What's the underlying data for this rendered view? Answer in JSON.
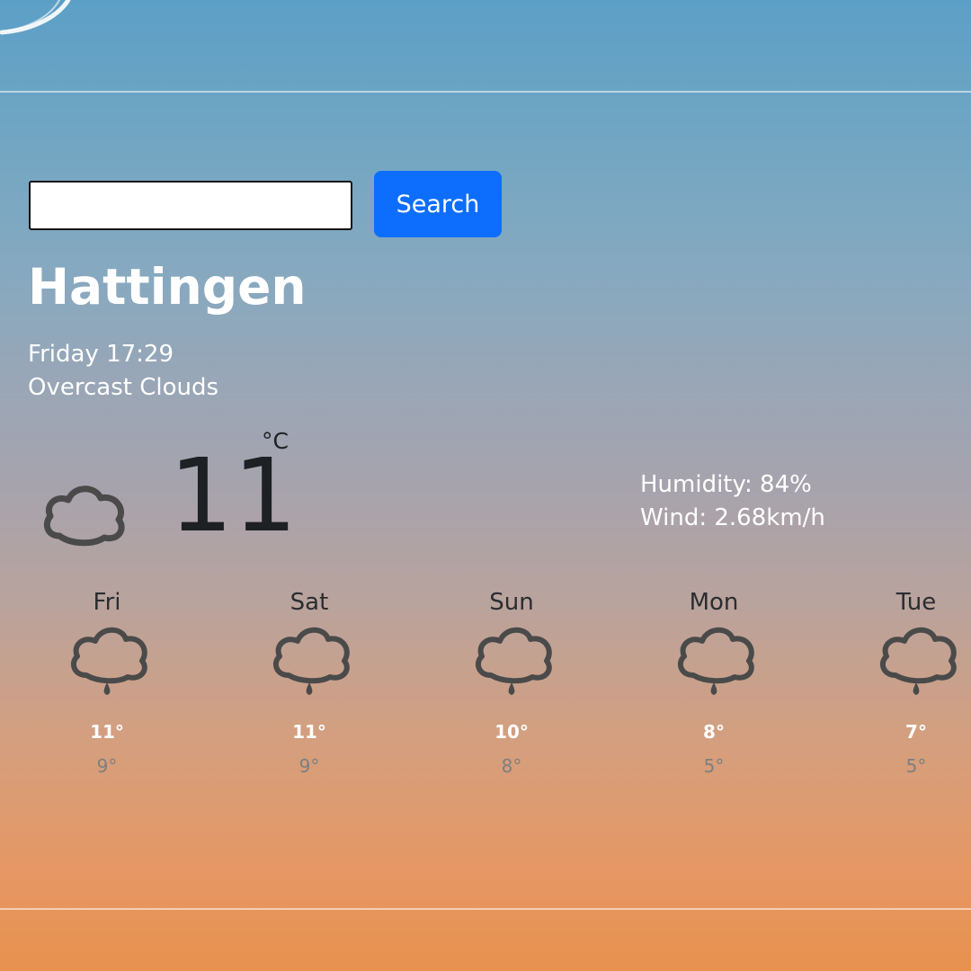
{
  "search": {
    "input_value": "",
    "button_label": "Search"
  },
  "current": {
    "city": "Hattingen",
    "datetime": "Friday 17:29",
    "description": "Overcast Clouds",
    "icon": "cloud-icon",
    "temperature": "11",
    "unit": "°C",
    "humidity": "Humidity: 84%",
    "wind": "Wind: 2.68km/h"
  },
  "forecast": [
    {
      "day": "Fri",
      "high": "11°",
      "low": "9°",
      "icon": "rain-cloud-icon"
    },
    {
      "day": "Sat",
      "high": "11°",
      "low": "9°",
      "icon": "rain-cloud-icon"
    },
    {
      "day": "Sun",
      "high": "10°",
      "low": "8°",
      "icon": "rain-cloud-icon"
    },
    {
      "day": "Mon",
      "high": "8°",
      "low": "5°",
      "icon": "rain-cloud-icon"
    },
    {
      "day": "Tue",
      "high": "7°",
      "low": "5°",
      "icon": "rain-cloud-icon"
    }
  ],
  "colors": {
    "button": "#0d6efd",
    "temperature_text": "#1e2124",
    "icon_stroke": "#4a4a4a"
  }
}
